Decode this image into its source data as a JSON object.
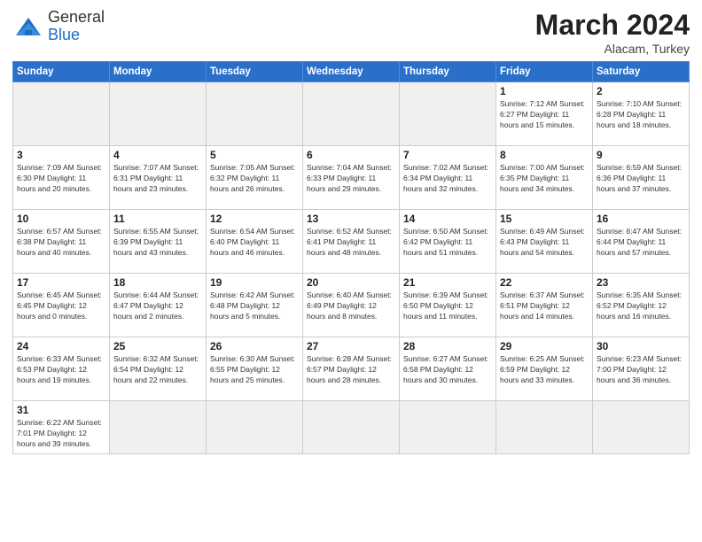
{
  "header": {
    "logo_general": "General",
    "logo_blue": "Blue",
    "month_title": "March 2024",
    "location": "Alacam, Turkey"
  },
  "weekdays": [
    "Sunday",
    "Monday",
    "Tuesday",
    "Wednesday",
    "Thursday",
    "Friday",
    "Saturday"
  ],
  "weeks": [
    [
      {
        "day": "",
        "info": "",
        "empty": true
      },
      {
        "day": "",
        "info": "",
        "empty": true
      },
      {
        "day": "",
        "info": "",
        "empty": true
      },
      {
        "day": "",
        "info": "",
        "empty": true
      },
      {
        "day": "",
        "info": "",
        "empty": true
      },
      {
        "day": "1",
        "info": "Sunrise: 7:12 AM\nSunset: 6:27 PM\nDaylight: 11 hours and 15 minutes."
      },
      {
        "day": "2",
        "info": "Sunrise: 7:10 AM\nSunset: 6:28 PM\nDaylight: 11 hours and 18 minutes."
      }
    ],
    [
      {
        "day": "3",
        "info": "Sunrise: 7:09 AM\nSunset: 6:30 PM\nDaylight: 11 hours and 20 minutes."
      },
      {
        "day": "4",
        "info": "Sunrise: 7:07 AM\nSunset: 6:31 PM\nDaylight: 11 hours and 23 minutes."
      },
      {
        "day": "5",
        "info": "Sunrise: 7:05 AM\nSunset: 6:32 PM\nDaylight: 11 hours and 26 minutes."
      },
      {
        "day": "6",
        "info": "Sunrise: 7:04 AM\nSunset: 6:33 PM\nDaylight: 11 hours and 29 minutes."
      },
      {
        "day": "7",
        "info": "Sunrise: 7:02 AM\nSunset: 6:34 PM\nDaylight: 11 hours and 32 minutes."
      },
      {
        "day": "8",
        "info": "Sunrise: 7:00 AM\nSunset: 6:35 PM\nDaylight: 11 hours and 34 minutes."
      },
      {
        "day": "9",
        "info": "Sunrise: 6:59 AM\nSunset: 6:36 PM\nDaylight: 11 hours and 37 minutes."
      }
    ],
    [
      {
        "day": "10",
        "info": "Sunrise: 6:57 AM\nSunset: 6:38 PM\nDaylight: 11 hours and 40 minutes."
      },
      {
        "day": "11",
        "info": "Sunrise: 6:55 AM\nSunset: 6:39 PM\nDaylight: 11 hours and 43 minutes."
      },
      {
        "day": "12",
        "info": "Sunrise: 6:54 AM\nSunset: 6:40 PM\nDaylight: 11 hours and 46 minutes."
      },
      {
        "day": "13",
        "info": "Sunrise: 6:52 AM\nSunset: 6:41 PM\nDaylight: 11 hours and 48 minutes."
      },
      {
        "day": "14",
        "info": "Sunrise: 6:50 AM\nSunset: 6:42 PM\nDaylight: 11 hours and 51 minutes."
      },
      {
        "day": "15",
        "info": "Sunrise: 6:49 AM\nSunset: 6:43 PM\nDaylight: 11 hours and 54 minutes."
      },
      {
        "day": "16",
        "info": "Sunrise: 6:47 AM\nSunset: 6:44 PM\nDaylight: 11 hours and 57 minutes."
      }
    ],
    [
      {
        "day": "17",
        "info": "Sunrise: 6:45 AM\nSunset: 6:45 PM\nDaylight: 12 hours and 0 minutes."
      },
      {
        "day": "18",
        "info": "Sunrise: 6:44 AM\nSunset: 6:47 PM\nDaylight: 12 hours and 2 minutes."
      },
      {
        "day": "19",
        "info": "Sunrise: 6:42 AM\nSunset: 6:48 PM\nDaylight: 12 hours and 5 minutes."
      },
      {
        "day": "20",
        "info": "Sunrise: 6:40 AM\nSunset: 6:49 PM\nDaylight: 12 hours and 8 minutes."
      },
      {
        "day": "21",
        "info": "Sunrise: 6:39 AM\nSunset: 6:50 PM\nDaylight: 12 hours and 11 minutes."
      },
      {
        "day": "22",
        "info": "Sunrise: 6:37 AM\nSunset: 6:51 PM\nDaylight: 12 hours and 14 minutes."
      },
      {
        "day": "23",
        "info": "Sunrise: 6:35 AM\nSunset: 6:52 PM\nDaylight: 12 hours and 16 minutes."
      }
    ],
    [
      {
        "day": "24",
        "info": "Sunrise: 6:33 AM\nSunset: 6:53 PM\nDaylight: 12 hours and 19 minutes."
      },
      {
        "day": "25",
        "info": "Sunrise: 6:32 AM\nSunset: 6:54 PM\nDaylight: 12 hours and 22 minutes."
      },
      {
        "day": "26",
        "info": "Sunrise: 6:30 AM\nSunset: 6:55 PM\nDaylight: 12 hours and 25 minutes."
      },
      {
        "day": "27",
        "info": "Sunrise: 6:28 AM\nSunset: 6:57 PM\nDaylight: 12 hours and 28 minutes."
      },
      {
        "day": "28",
        "info": "Sunrise: 6:27 AM\nSunset: 6:58 PM\nDaylight: 12 hours and 30 minutes."
      },
      {
        "day": "29",
        "info": "Sunrise: 6:25 AM\nSunset: 6:59 PM\nDaylight: 12 hours and 33 minutes."
      },
      {
        "day": "30",
        "info": "Sunrise: 6:23 AM\nSunset: 7:00 PM\nDaylight: 12 hours and 36 minutes."
      }
    ],
    [
      {
        "day": "31",
        "info": "Sunrise: 6:22 AM\nSunset: 7:01 PM\nDaylight: 12 hours and 39 minutes."
      },
      {
        "day": "",
        "info": "",
        "empty": true
      },
      {
        "day": "",
        "info": "",
        "empty": true
      },
      {
        "day": "",
        "info": "",
        "empty": true
      },
      {
        "day": "",
        "info": "",
        "empty": true
      },
      {
        "day": "",
        "info": "",
        "empty": true
      },
      {
        "day": "",
        "info": "",
        "empty": true
      }
    ]
  ]
}
